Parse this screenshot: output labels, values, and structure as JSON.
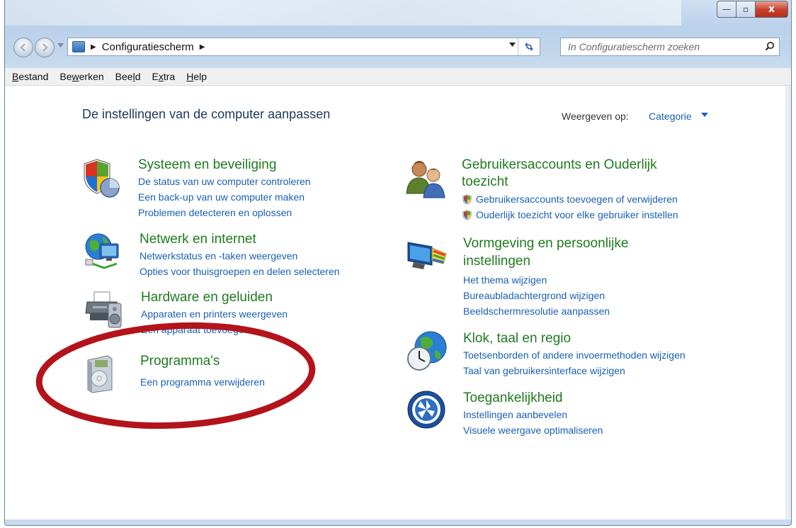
{
  "window": {
    "controls": {
      "minimize": "—",
      "maximize": "▫",
      "close": "x"
    }
  },
  "nav": {
    "address_path": "Configuratiescherm",
    "address_sep": "▶",
    "search_placeholder": "In Configuratiescherm zoeken"
  },
  "menu": {
    "items": [
      {
        "pre": "",
        "ul": "B",
        "post": "estand"
      },
      {
        "pre": "Be",
        "ul": "w",
        "post": "erken"
      },
      {
        "pre": "Bee",
        "ul": "l",
        "post": "d"
      },
      {
        "pre": "E",
        "ul": "x",
        "post": "tra"
      },
      {
        "pre": "",
        "ul": "H",
        "post": "elp"
      }
    ]
  },
  "header": {
    "title": "De instellingen van de computer aanpassen",
    "view_by_label": "Weergeven op:",
    "view_by_value": "Categorie"
  },
  "categories": {
    "system": {
      "title": "Systeem en beveiliging",
      "icon": "shield-chart-icon",
      "links": [
        "De status van uw computer controleren",
        "Een back-up van uw computer maken",
        "Problemen detecteren en oplossen"
      ]
    },
    "network": {
      "title": "Netwerk en internet",
      "icon": "globe-network-icon",
      "links": [
        "Netwerkstatus en -taken weergeven",
        "Opties voor thuisgroepen en delen selecteren"
      ]
    },
    "hardware": {
      "title": "Hardware en geluiden",
      "icon": "printer-speaker-icon",
      "links": [
        "Apparaten en printers weergeven",
        "Een apparaat toevoegen"
      ]
    },
    "programs": {
      "title": "Programma's",
      "icon": "programs-disc-icon",
      "links": [
        "Een programma verwijderen"
      ]
    },
    "users": {
      "title_line1": "Gebruikersaccounts en Ouderlijk",
      "title_line2": "toezicht",
      "icon": "users-icon",
      "links": [
        "Gebruikersaccounts toevoegen of verwijderen",
        "Ouderlijk toezicht voor elke gebruiker instellen"
      ]
    },
    "appearance": {
      "title_line1": "Vormgeving en persoonlijke",
      "title_line2": "instellingen",
      "icon": "monitor-paint-icon",
      "links": [
        "Het thema wijzigen",
        "Bureaubladachtergrond wijzigen",
        "Beeldschermresolutie aanpassen"
      ]
    },
    "clock": {
      "title": "Klok, taal en regio",
      "icon": "globe-clock-icon",
      "links": [
        "Toetsenborden of andere invoermethoden wijzigen",
        "Taal van gebruikersinterface wijzigen"
      ]
    },
    "access": {
      "title": "Toegankelijkheid",
      "icon": "accessibility-icon",
      "links": [
        "Instellingen aanbevelen",
        "Visuele weergave optimaliseren"
      ]
    }
  },
  "colors": {
    "category_title": "#1f7b1f",
    "link": "#1a5fb4",
    "page_title": "#1e395b",
    "annotation_ellipse": "#b3131a"
  }
}
